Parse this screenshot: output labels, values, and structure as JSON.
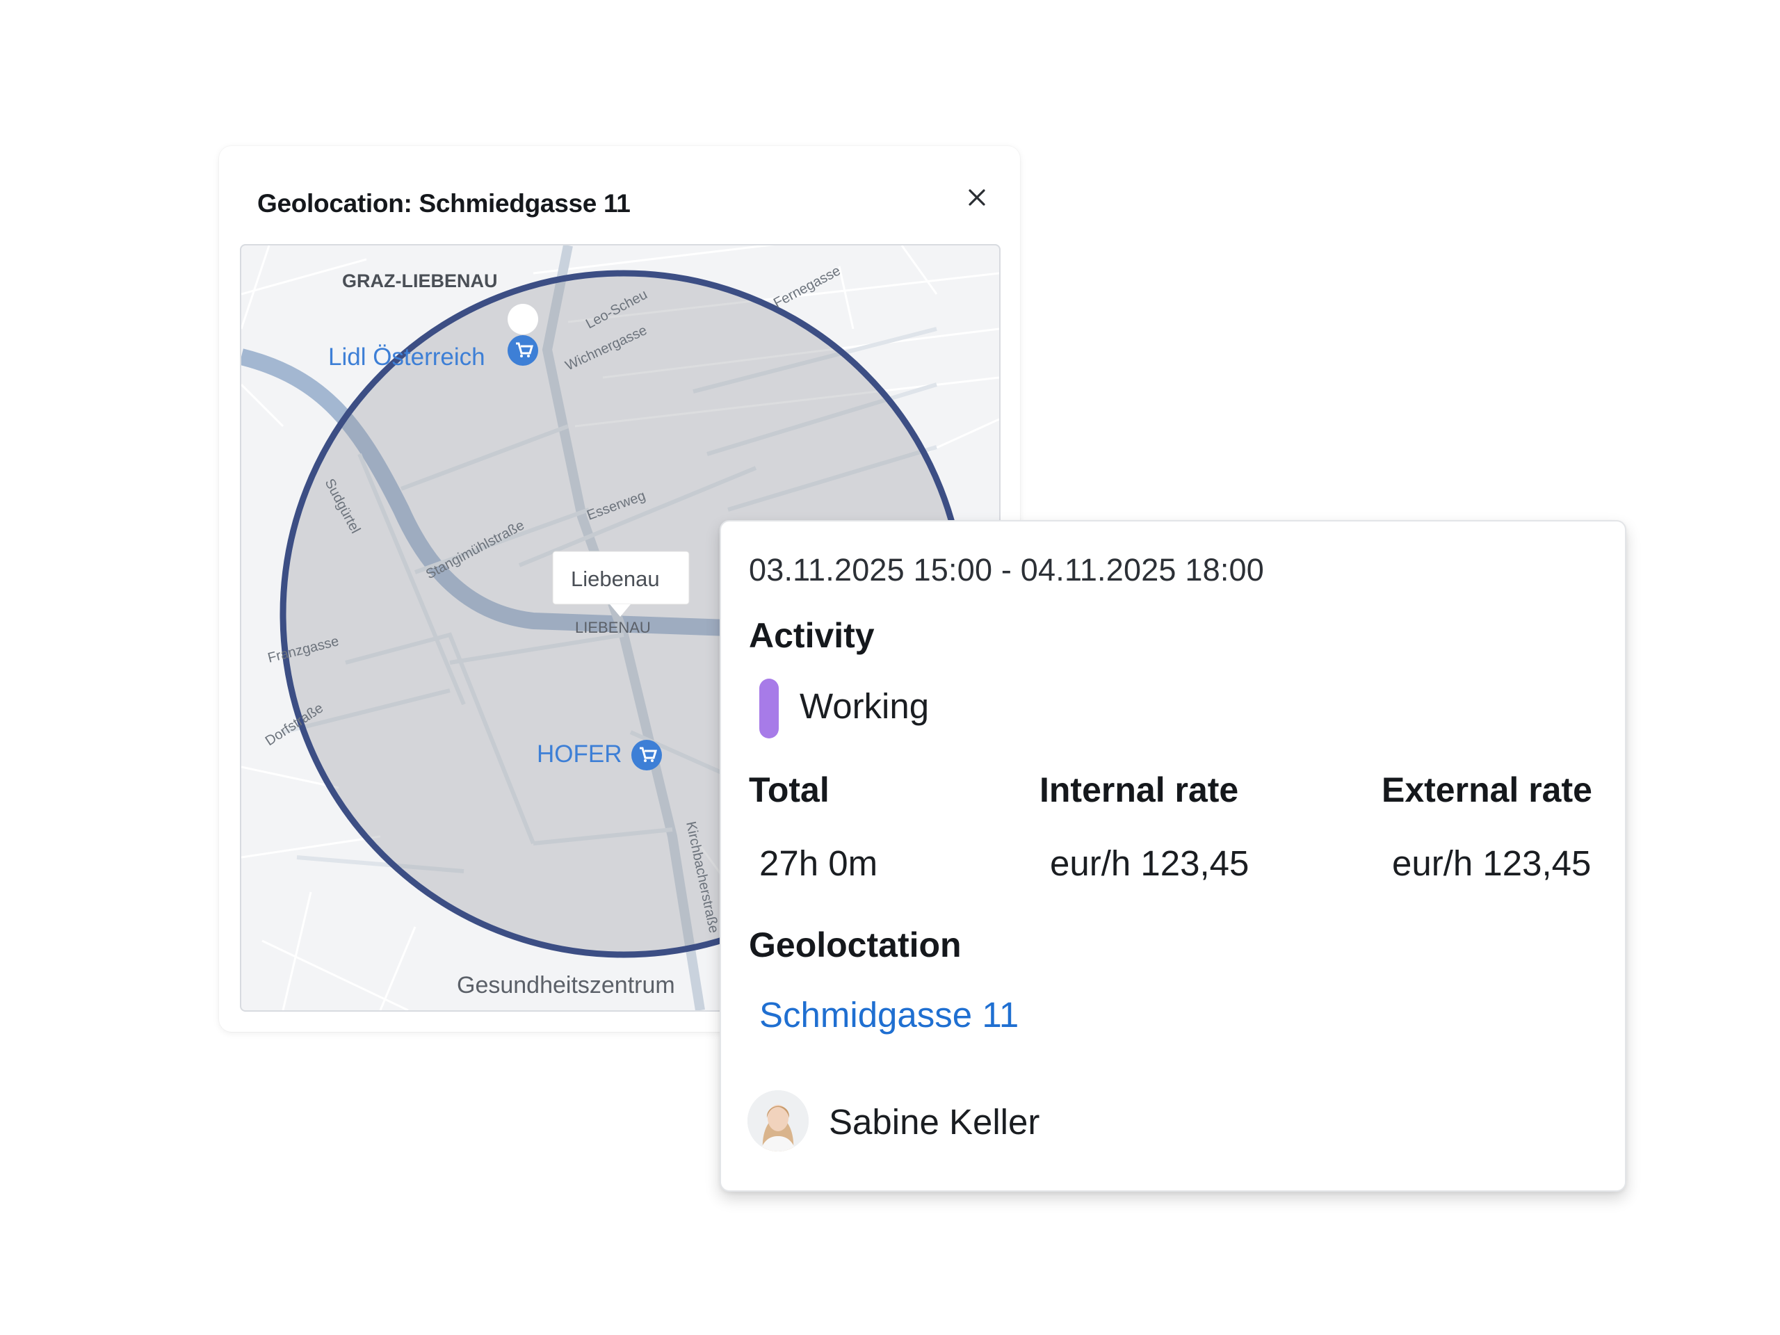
{
  "modal": {
    "title": "Geolocation: Schmiedgasse 11",
    "close_icon": "close-icon"
  },
  "map": {
    "district_label": "GRAZ-LIEBENAU",
    "poi_1": "Lidl Österreich",
    "poi_2": "HOFER",
    "place_tooltip": "Liebenau",
    "place_small": "LIEBENAU",
    "bottom_label": "Gesundheitszentrum",
    "streets": [
      "Sudgürtel",
      "Stangimühlstraße",
      "Esserweg",
      "Wichnergasse",
      "Leo-Scheu",
      "Franzgasse",
      "Dorfstraße",
      "Kirchbacherstraße",
      "Fernegasse"
    ],
    "radius_color": "#3c4e84",
    "poi_icon": "shopping-cart-icon"
  },
  "detail": {
    "date_range": "03.11.2025 15:00 - 04.11.2025 18:00",
    "activity_label": "Activity",
    "activity_name": "Working",
    "activity_color": "#a77be8",
    "total_label": "Total",
    "total_value": "27h 0m",
    "internal_rate_label": "Internal rate",
    "internal_rate_value": "eur/h 123,45",
    "external_rate_label": "External rate",
    "external_rate_value": "eur/h 123,45",
    "geolocation_label": "Geoloctation",
    "geolocation_link": "Schmidgasse 11",
    "link_color": "#1f6fd1",
    "user_name": "Sabine Keller"
  }
}
